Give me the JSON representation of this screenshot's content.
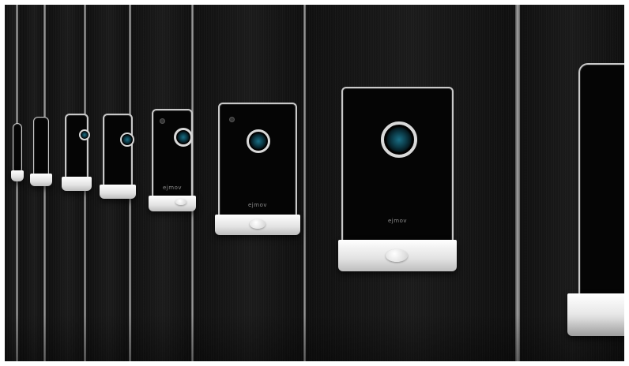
{
  "image": {
    "subject": "row of wall-mounted access control panels with camera lenses on dark wood panels",
    "colors": {
      "panel": "#141414",
      "frame": "#c9c9c9",
      "lens": "#1a6f86",
      "shelf": "#f2f2f2"
    }
  },
  "devices": [
    {
      "brand": "ejmov"
    },
    {
      "brand": "ejmov"
    },
    {
      "brand": "ejmov"
    }
  ]
}
